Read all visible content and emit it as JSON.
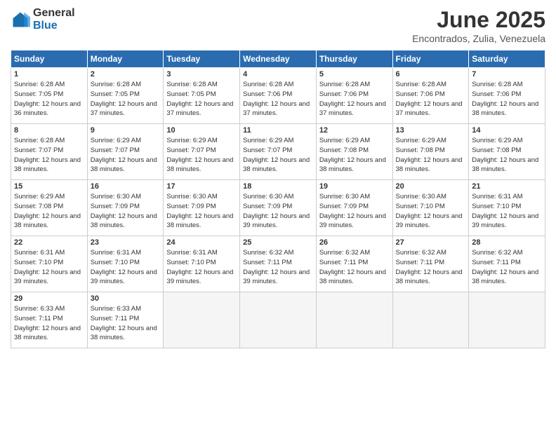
{
  "logo": {
    "general": "General",
    "blue": "Blue"
  },
  "title": "June 2025",
  "location": "Encontrados, Zulia, Venezuela",
  "days_header": [
    "Sunday",
    "Monday",
    "Tuesday",
    "Wednesday",
    "Thursday",
    "Friday",
    "Saturday"
  ],
  "weeks": [
    [
      {
        "day": "1",
        "sunrise": "6:28 AM",
        "sunset": "7:05 PM",
        "daylight": "12 hours and 36 minutes."
      },
      {
        "day": "2",
        "sunrise": "6:28 AM",
        "sunset": "7:05 PM",
        "daylight": "12 hours and 37 minutes."
      },
      {
        "day": "3",
        "sunrise": "6:28 AM",
        "sunset": "7:05 PM",
        "daylight": "12 hours and 37 minutes."
      },
      {
        "day": "4",
        "sunrise": "6:28 AM",
        "sunset": "7:06 PM",
        "daylight": "12 hours and 37 minutes."
      },
      {
        "day": "5",
        "sunrise": "6:28 AM",
        "sunset": "7:06 PM",
        "daylight": "12 hours and 37 minutes."
      },
      {
        "day": "6",
        "sunrise": "6:28 AM",
        "sunset": "7:06 PM",
        "daylight": "12 hours and 37 minutes."
      },
      {
        "day": "7",
        "sunrise": "6:28 AM",
        "sunset": "7:06 PM",
        "daylight": "12 hours and 38 minutes."
      }
    ],
    [
      {
        "day": "8",
        "sunrise": "6:28 AM",
        "sunset": "7:07 PM",
        "daylight": "12 hours and 38 minutes."
      },
      {
        "day": "9",
        "sunrise": "6:29 AM",
        "sunset": "7:07 PM",
        "daylight": "12 hours and 38 minutes."
      },
      {
        "day": "10",
        "sunrise": "6:29 AM",
        "sunset": "7:07 PM",
        "daylight": "12 hours and 38 minutes."
      },
      {
        "day": "11",
        "sunrise": "6:29 AM",
        "sunset": "7:07 PM",
        "daylight": "12 hours and 38 minutes."
      },
      {
        "day": "12",
        "sunrise": "6:29 AM",
        "sunset": "7:08 PM",
        "daylight": "12 hours and 38 minutes."
      },
      {
        "day": "13",
        "sunrise": "6:29 AM",
        "sunset": "7:08 PM",
        "daylight": "12 hours and 38 minutes."
      },
      {
        "day": "14",
        "sunrise": "6:29 AM",
        "sunset": "7:08 PM",
        "daylight": "12 hours and 38 minutes."
      }
    ],
    [
      {
        "day": "15",
        "sunrise": "6:29 AM",
        "sunset": "7:08 PM",
        "daylight": "12 hours and 38 minutes."
      },
      {
        "day": "16",
        "sunrise": "6:30 AM",
        "sunset": "7:09 PM",
        "daylight": "12 hours and 38 minutes."
      },
      {
        "day": "17",
        "sunrise": "6:30 AM",
        "sunset": "7:09 PM",
        "daylight": "12 hours and 38 minutes."
      },
      {
        "day": "18",
        "sunrise": "6:30 AM",
        "sunset": "7:09 PM",
        "daylight": "12 hours and 39 minutes."
      },
      {
        "day": "19",
        "sunrise": "6:30 AM",
        "sunset": "7:09 PM",
        "daylight": "12 hours and 39 minutes."
      },
      {
        "day": "20",
        "sunrise": "6:30 AM",
        "sunset": "7:10 PM",
        "daylight": "12 hours and 39 minutes."
      },
      {
        "day": "21",
        "sunrise": "6:31 AM",
        "sunset": "7:10 PM",
        "daylight": "12 hours and 39 minutes."
      }
    ],
    [
      {
        "day": "22",
        "sunrise": "6:31 AM",
        "sunset": "7:10 PM",
        "daylight": "12 hours and 39 minutes."
      },
      {
        "day": "23",
        "sunrise": "6:31 AM",
        "sunset": "7:10 PM",
        "daylight": "12 hours and 39 minutes."
      },
      {
        "day": "24",
        "sunrise": "6:31 AM",
        "sunset": "7:10 PM",
        "daylight": "12 hours and 39 minutes."
      },
      {
        "day": "25",
        "sunrise": "6:32 AM",
        "sunset": "7:11 PM",
        "daylight": "12 hours and 39 minutes."
      },
      {
        "day": "26",
        "sunrise": "6:32 AM",
        "sunset": "7:11 PM",
        "daylight": "12 hours and 38 minutes."
      },
      {
        "day": "27",
        "sunrise": "6:32 AM",
        "sunset": "7:11 PM",
        "daylight": "12 hours and 38 minutes."
      },
      {
        "day": "28",
        "sunrise": "6:32 AM",
        "sunset": "7:11 PM",
        "daylight": "12 hours and 38 minutes."
      }
    ],
    [
      {
        "day": "29",
        "sunrise": "6:33 AM",
        "sunset": "7:11 PM",
        "daylight": "12 hours and 38 minutes."
      },
      {
        "day": "30",
        "sunrise": "6:33 AM",
        "sunset": "7:11 PM",
        "daylight": "12 hours and 38 minutes."
      },
      null,
      null,
      null,
      null,
      null
    ]
  ]
}
